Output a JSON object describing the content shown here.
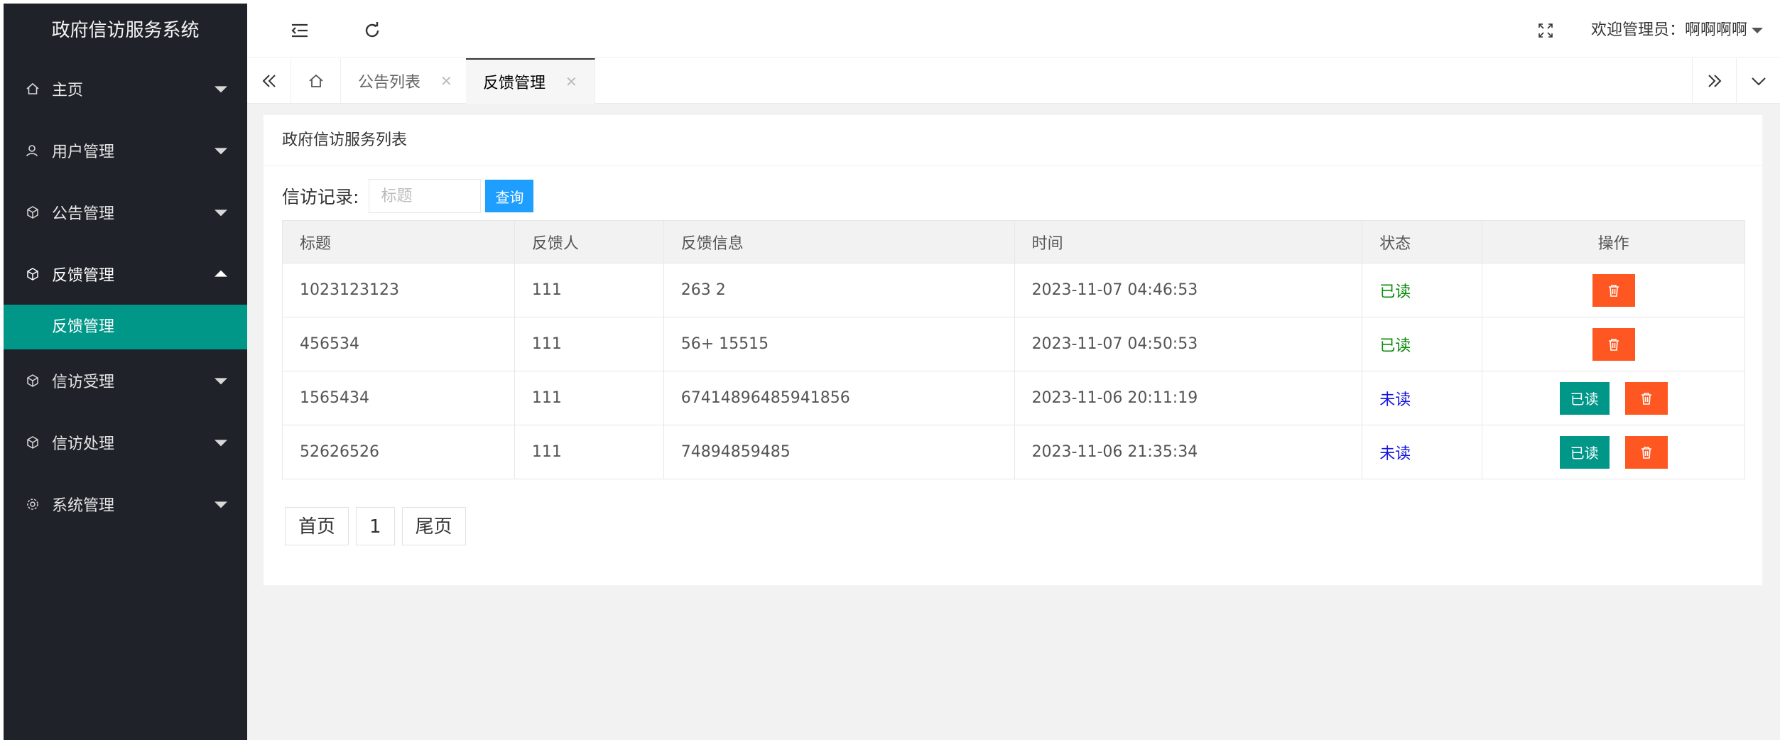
{
  "app": {
    "title": "政府信访服务系统"
  },
  "sidebar": {
    "items": [
      {
        "label": "主页",
        "icon": "home-icon"
      },
      {
        "label": "用户管理",
        "icon": "user-icon"
      },
      {
        "label": "公告管理",
        "icon": "cube-icon"
      },
      {
        "label": "反馈管理",
        "icon": "cube-icon",
        "open": true,
        "sub": [
          "反馈管理"
        ]
      },
      {
        "label": "信访受理",
        "icon": "cube-icon"
      },
      {
        "label": "信访处理",
        "icon": "cube-icon"
      },
      {
        "label": "系统管理",
        "icon": "gear-icon"
      }
    ]
  },
  "header": {
    "welcome": "欢迎管理员：啊啊啊啊"
  },
  "tabs": [
    {
      "label": "公告列表",
      "active": false
    },
    {
      "label": "反馈管理",
      "active": true
    }
  ],
  "panel": {
    "title": "政府信访服务列表"
  },
  "search": {
    "label": "信访记录:",
    "placeholder": "标题",
    "button": "查询"
  },
  "table": {
    "headers": [
      "标题",
      "反馈人",
      "反馈信息",
      "时间",
      "状态",
      "操作"
    ],
    "rows": [
      {
        "title": "1023123123",
        "user": "111",
        "info": "263 2",
        "time": "2023-11-07 04:46:53",
        "status": "已读"
      },
      {
        "title": "456534",
        "user": "111",
        "info": "56+ 15515",
        "time": "2023-11-07 04:50:53",
        "status": "已读"
      },
      {
        "title": "1565434",
        "user": "111",
        "info": "67414896485941856",
        "time": "2023-11-06 20:11:19",
        "status": "未读"
      },
      {
        "title": "52626526",
        "user": "111",
        "info": "74894859485",
        "time": "2023-11-06 21:35:34",
        "status": "未读"
      }
    ],
    "read_button": "已读"
  },
  "pager": {
    "first": "首页",
    "page": "1",
    "last": "尾页"
  },
  "colors": {
    "sidebar": "#20222a",
    "active": "#009688",
    "danger": "#ff5722",
    "primary": "#1e9fff"
  }
}
